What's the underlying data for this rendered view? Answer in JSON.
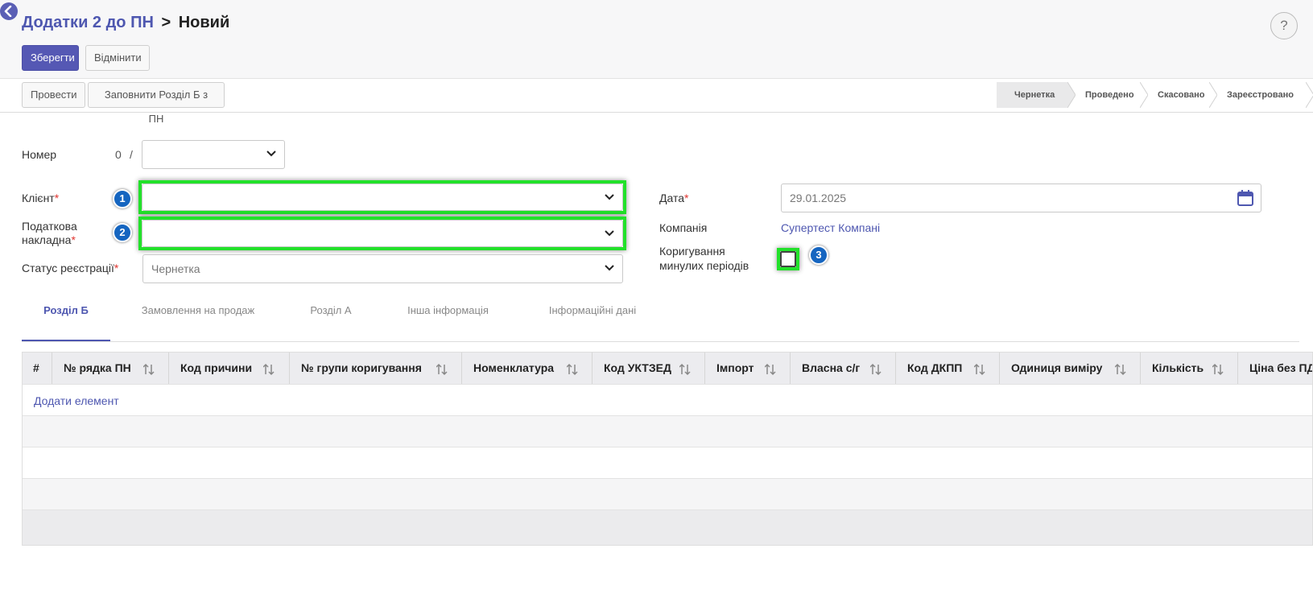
{
  "header": {
    "breadcrumb_parent": "Додатки 2 до ПН",
    "breadcrumb_separator": ">",
    "breadcrumb_current": "Новий",
    "help_label": "?",
    "save_label": "Зберегти",
    "cancel_label": "Відмінити"
  },
  "actions": {
    "post_label": "Провести",
    "fill_label": "Заповнити Розділ Б з ПН"
  },
  "stages": [
    "Чернетка",
    "Проведено",
    "Скасовано",
    "Зареєстровано"
  ],
  "form": {
    "number_label": "Номер",
    "number_prefix": "0",
    "number_slash": "/",
    "client_label": "Клієнт",
    "invoice_label_1": "Податкова",
    "invoice_label_2": "накладна",
    "reg_status_label": "Статус реєстрації",
    "reg_status_value": "Чернетка",
    "date_label": "Дата",
    "date_value": "29.01.2025",
    "company_label": "Компанія",
    "company_value": "Супертест Компані",
    "correction_label_1": "Коригування",
    "correction_label_2": "минулих періодів",
    "required_mark": "*"
  },
  "markers": [
    "1",
    "2",
    "3"
  ],
  "tabs": [
    "Розділ Б",
    "Замовлення на продаж",
    "Розділ А",
    "Інша інформація",
    "Інформаційні дані"
  ],
  "table": {
    "columns": [
      "#",
      "№ рядка ПН",
      "Код причини",
      "№ групи коригування",
      "Номенклатура",
      "Код УКТЗЕД",
      "Імпорт",
      "Власна с/г",
      "Код ДКПП",
      "Одиниця виміру",
      "Кількість",
      "Ціна без ПДВ"
    ],
    "add_item_label": "Додати елемент"
  },
  "colors": {
    "accent": "#4e57b0",
    "highlight": "#22e12a",
    "marker": "#1565c0",
    "required": "#e0342f"
  }
}
